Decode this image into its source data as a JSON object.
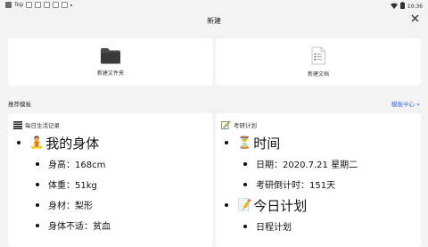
{
  "status_bar": {
    "left_text": "Top",
    "time": "10:36"
  },
  "header": {
    "title": "新建"
  },
  "new_items": [
    {
      "label": "新建文件夹",
      "icon": "folder-icon"
    },
    {
      "label": "新建文档",
      "icon": "document-icon"
    }
  ],
  "recommended": {
    "title": "推荐模板",
    "more_link": "模板中心 »"
  },
  "templates": [
    {
      "name": "每日生活记录",
      "icon": "list-icon",
      "sections": [
        {
          "heading": "我的身体",
          "emoji": "🧘",
          "items": [
            "身高：168cm",
            "体重：51kg",
            "身材：梨形",
            "身体不适：贫血"
          ]
        }
      ]
    },
    {
      "name": "考研计划",
      "icon": "pencil-note-icon",
      "sections": [
        {
          "heading": "时间",
          "emoji": "⏳",
          "items": [
            "日期：2020.7.21 星期二",
            "考研倒计时：151天"
          ]
        },
        {
          "heading": "今日计划",
          "emoji": "📝",
          "items": [
            "日程计划"
          ]
        }
      ]
    }
  ]
}
